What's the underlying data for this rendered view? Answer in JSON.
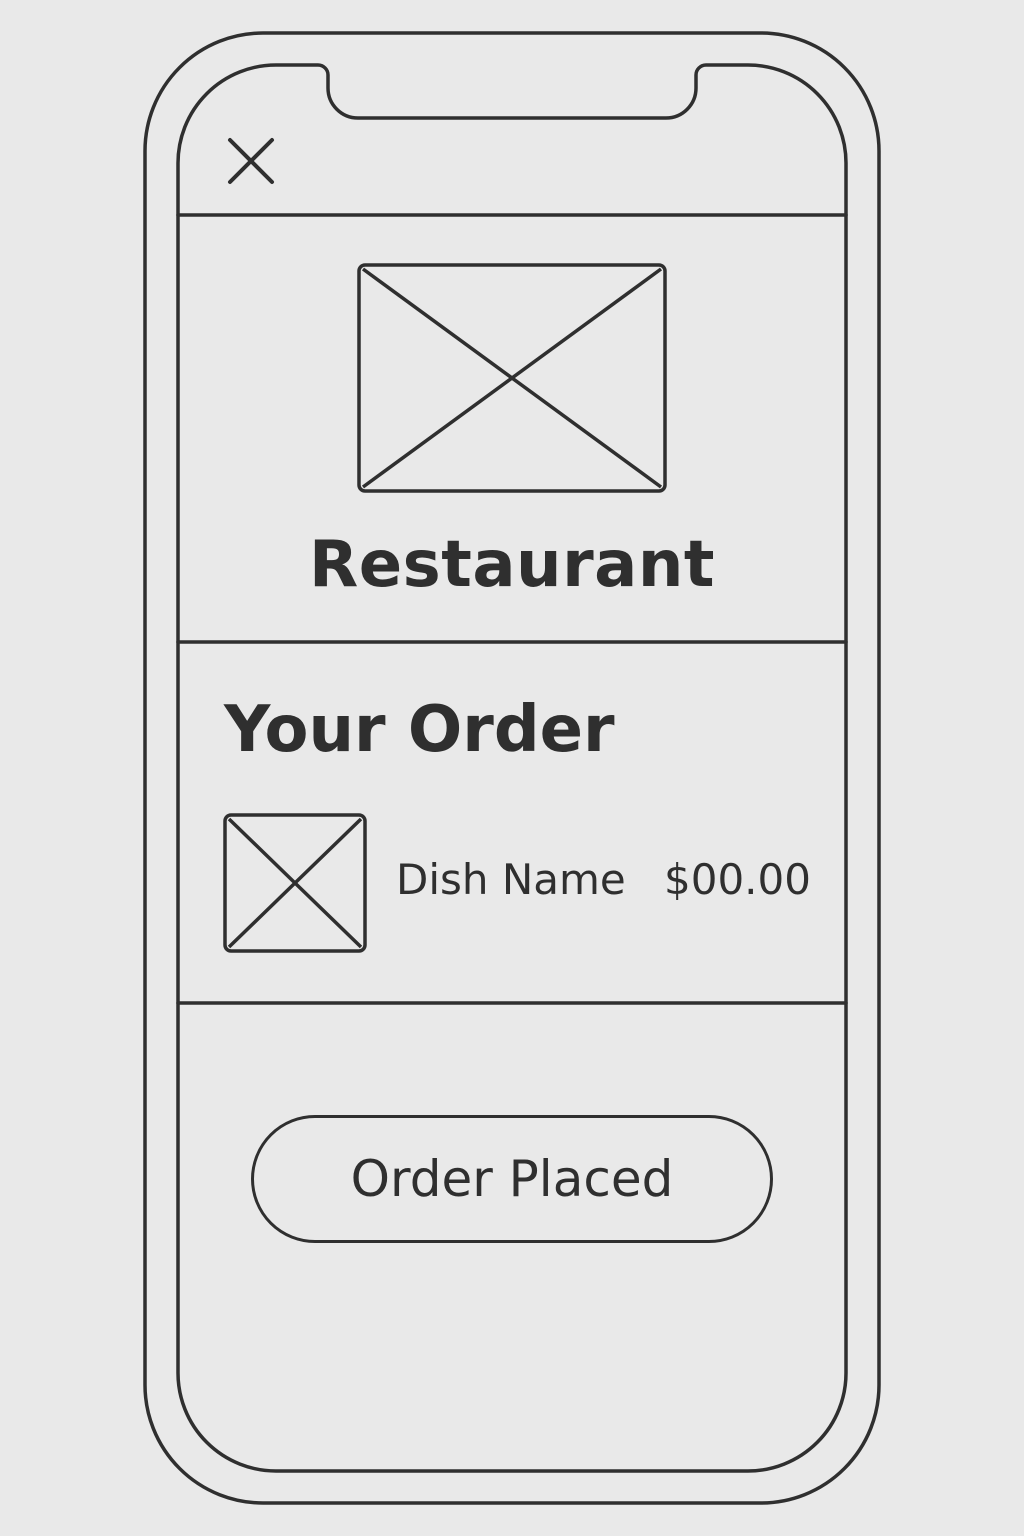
{
  "header": {
    "close_icon": "close-icon"
  },
  "restaurant": {
    "image_icon": "image-placeholder-icon",
    "name": "Restaurant"
  },
  "order": {
    "heading": "Your Order",
    "items": [
      {
        "thumbnail_icon": "image-placeholder-icon",
        "name": "Dish Name",
        "price": "$00.00"
      }
    ]
  },
  "footer": {
    "button_label": "Order Placed"
  },
  "colors": {
    "background": "#e9e9e9",
    "stroke": "#2f2f2f"
  }
}
